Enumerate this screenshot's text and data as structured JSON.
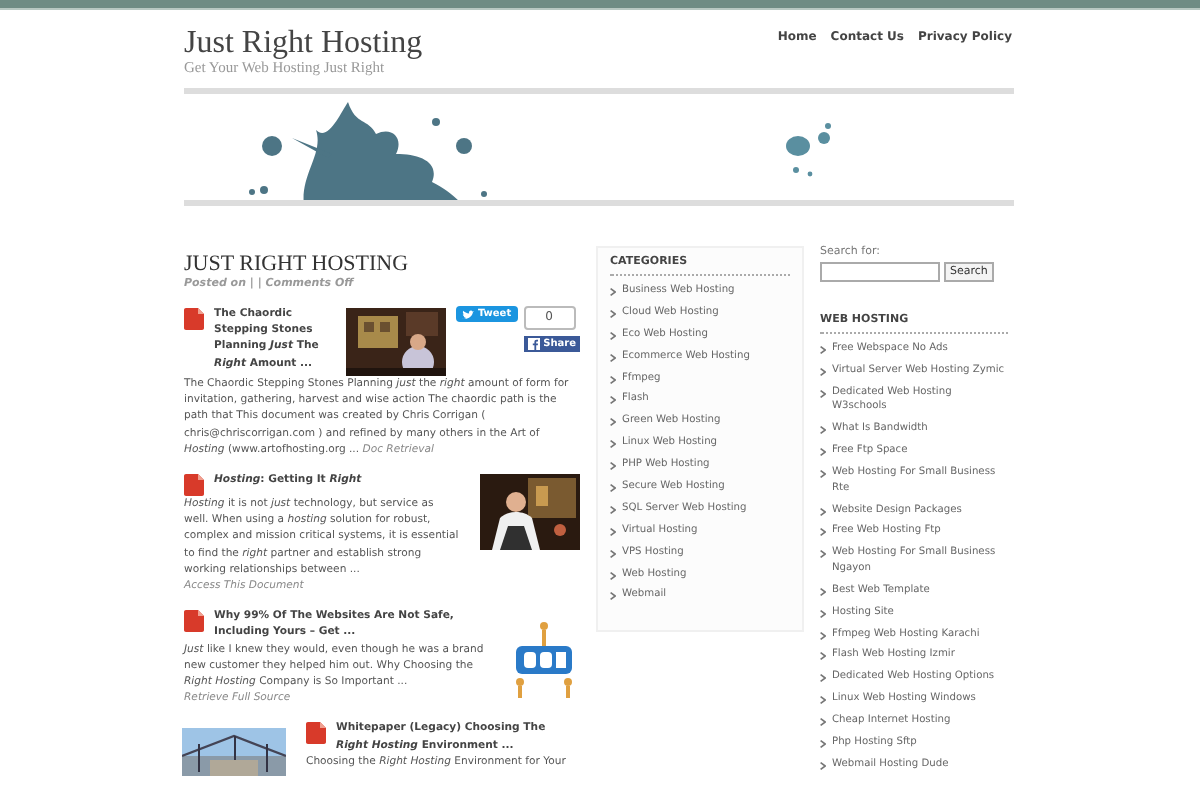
{
  "site": {
    "title": "Just Right Hosting",
    "tagline": "Get Your Web Hosting Just Right"
  },
  "nav": [
    "Home",
    "Contact Us",
    "Privacy Policy"
  ],
  "post": {
    "title": "JUST RIGHT HOSTING",
    "meta": "Posted on | | Comments Off",
    "share": {
      "tweet": "Tweet",
      "count": "0",
      "share": "Share"
    },
    "articles": [
      {
        "title": "The Chaordic Stepping Stones Planning *Just* The *Right* Amount ...",
        "body": "The Chaordic Stepping Stones Planning *just* the *right* amount of form for invitation, gathering, harvest and wise action The chaordic path is the path that This document was created by Chris Corrigan ( chris@chriscorrigan.com ) and refined by many others in the Art of *Hosting* (www.artofhosting.org ...",
        "link": "Doc Retrieval"
      },
      {
        "title": "*Hosting*: Getting It *Right*",
        "body": "*Hosting* it is not *just* technology, but service as well. When using a *hosting* solution for robust, complex and mission critical systems, it is essential to find the *right* partner and establish strong working relationships between ...",
        "link": "Access This Document"
      },
      {
        "title": "Why 99% Of The Websites Are Not Safe, Including Yours – Get ...",
        "body": "*Just* like I knew they would, even though he was a brand new customer they helped him out. Why Choosing the *Right Hosting* Company is So Important ...",
        "link": "Retrieve Full Source"
      },
      {
        "title": "Whitepaper (Legacy) Choosing The *Right Hosting* Environment ...",
        "body": "Choosing the *Right Hosting* Environment for Your"
      }
    ]
  },
  "categories": {
    "heading": "CATEGORIES",
    "items": [
      "Business Web Hosting",
      "Cloud Web Hosting",
      "Eco Web Hosting",
      "Ecommerce Web Hosting",
      "Ffmpeg",
      "Flash",
      "Green Web Hosting",
      "Linux Web Hosting",
      "PHP Web Hosting",
      "Secure Web Hosting",
      "SQL Server Web Hosting",
      "Virtual Hosting",
      "VPS Hosting",
      "Web Hosting",
      "Webmail"
    ]
  },
  "search": {
    "label": "Search for:",
    "button": "Search"
  },
  "web_hosting": {
    "heading": "WEB HOSTING",
    "items": [
      "Free Webspace No Ads",
      "Virtual Server Web Hosting Zymic",
      "Dedicated Web Hosting W3schools",
      "What Is Bandwidth",
      "Free Ftp Space",
      "Web Hosting For Small Business Rte",
      "Website Design Packages",
      "Free Web Hosting Ftp",
      "Web Hosting For Small Business Ngayon",
      "Best Web Template",
      "Hosting Site",
      "Ffmpeg Web Hosting Karachi",
      "Flash Web Hosting Izmir",
      "Dedicated Web Hosting Options",
      "Linux Web Hosting Windows",
      "Cheap Internet Hosting",
      "Php Hosting Sftp",
      "Webmail Hosting Dude"
    ]
  }
}
